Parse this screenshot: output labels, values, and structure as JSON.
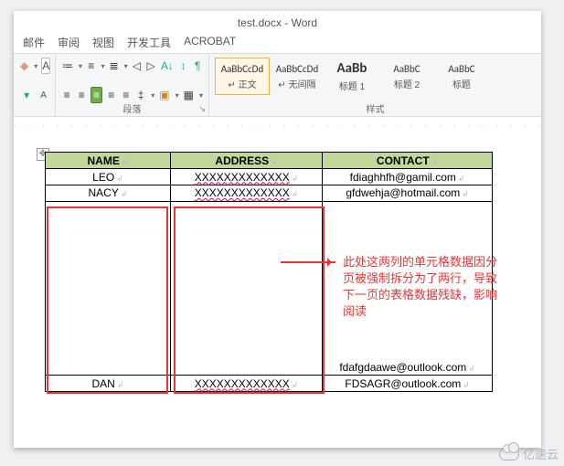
{
  "title": "test.docx - Word",
  "tabs": [
    "邮件",
    "审阅",
    "视图",
    "开发工具",
    "ACROBAT"
  ],
  "ribbon": {
    "group_para": "段落",
    "group_styles": "样式",
    "styles": [
      {
        "preview": "AaBbCcDd",
        "name": "↵ 正文",
        "sel": true,
        "big": false
      },
      {
        "preview": "AaBbCcDd",
        "name": "↵ 无间隔",
        "sel": false,
        "big": false
      },
      {
        "preview": "AaBb",
        "name": "标题 1",
        "sel": false,
        "big": true
      },
      {
        "preview": "AaBbC",
        "name": "标题 2",
        "sel": false,
        "big": false
      },
      {
        "preview": "AaBbC",
        "name": "标题",
        "sel": false,
        "big": false
      }
    ]
  },
  "table": {
    "headers": [
      "NAME",
      "ADDRESS",
      "CONTACT"
    ],
    "rows": [
      {
        "name": "LEO",
        "addr": "XXXXXXXXXXXXX",
        "contact": "fdiaghhfh@gamil.com"
      },
      {
        "name": "NACY",
        "addr": "XXXXXXXXXXXXX",
        "contact": "gfdwehja@hotmail.com"
      },
      {
        "name": "",
        "addr": "",
        "contact": "fdafgdaawe@outlook.com"
      },
      {
        "name": "DAN",
        "addr": "XXXXXXXXXXXXX",
        "contact": "FDSAGR@outlook.com"
      }
    ]
  },
  "callout_text": "此处这两列的单元格数据因分页被强制拆分为了两行，导致下一页的表格数据残缺，影响阅读",
  "watermark": "亿速云"
}
